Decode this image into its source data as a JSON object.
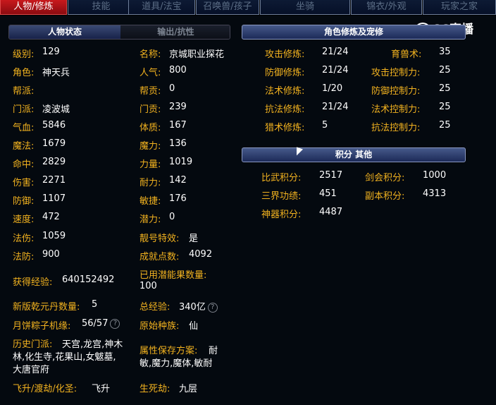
{
  "tabs": [
    {
      "label": "人物/修炼"
    },
    {
      "label": "技能"
    },
    {
      "label": "道具/法宝"
    },
    {
      "label": "召唤兽/孩子"
    },
    {
      "label": "坐骑"
    },
    {
      "label": "锦衣/外观"
    },
    {
      "label": "玩家之家"
    }
  ],
  "watermark": {
    "text": "CC直播",
    "logo": "cc-live-logo"
  },
  "left_header": {
    "tab1": "人物状态",
    "tab2": "输出/抗性"
  },
  "attrs": {
    "level_l": "级别:",
    "level_v": "129",
    "name_l": "名称:",
    "name_v": "京城职业探花",
    "role_l": "角色:",
    "role_v": "神天兵",
    "pop_l": "人气:",
    "pop_v": "800",
    "guild_l": "帮派:",
    "guild_v": "",
    "guildc_l": "帮贡:",
    "guildc_v": "0",
    "sect_l": "门派:",
    "sect_v": "凌波城",
    "sectc_l": "门贡:",
    "sectc_v": "239",
    "hp_l": "气血:",
    "hp_v": "5846",
    "con_l": "体质:",
    "con_v": "167",
    "mp_l": "魔法:",
    "mp_v": "1679",
    "mag_l": "魔力:",
    "mag_v": "136",
    "hit_l": "命中:",
    "hit_v": "2829",
    "str_l": "力量:",
    "str_v": "1019",
    "dmg_l": "伤害:",
    "dmg_v": "2271",
    "end_l": "耐力:",
    "end_v": "142",
    "def_l": "防御:",
    "def_v": "1107",
    "agi_l": "敏捷:",
    "agi_v": "176",
    "spd_l": "速度:",
    "spd_v": "472",
    "pot_l": "潜力:",
    "pot_v": "0",
    "mdmg_l": "法伤:",
    "mdmg_v": "1059",
    "title_l": "靓号特效:",
    "title_v": "是",
    "mdef_l": "法防:",
    "mdef_v": "900",
    "ach_l": "成就点数:",
    "ach_v": "4092",
    "exp_l": "获得经验:",
    "exp_v": "640152492",
    "potfruit_l": "已用潜能果数量:",
    "potfruit_v": "100",
    "qy_l": "新版乾元丹数量:",
    "qy_v": "5",
    "total_l": "总经验:",
    "total_v": "340亿",
    "moon_l": "月饼粽子机缘:",
    "moon_v": "56/57",
    "race_l": "原始种族:",
    "race_v": "仙",
    "hist_l": "历史门派:",
    "hist_v1": "天宫,龙宫,神木",
    "hist_v2": "林,化生寺,花果山,女魃墓,",
    "hist_v3": "大唐官府",
    "save_l": "属性保存方案:",
    "save_v1": "耐",
    "save_v2": "敏,魔力,魔体,敏耐",
    "fly_l": "飞升/渡劫/化圣:",
    "fly_v": "飞升",
    "life_l": "生死劫:",
    "life_v": "九层"
  },
  "cult_header": "角色修炼及宠修",
  "cult": {
    "atk_l": "攻击修炼:",
    "atk_v": "21/24",
    "beast_l": "育兽术:",
    "beast_v": "35",
    "def_l": "防御修炼:",
    "def_v": "21/24",
    "atkc_l": "攻击控制力:",
    "atkc_v": "25",
    "mag_l": "法术修炼:",
    "mag_v": "1/20",
    "defc_l": "防御控制力:",
    "defc_v": "25",
    "res_l": "抗法修炼:",
    "res_v": "21/24",
    "magc_l": "法术控制力:",
    "magc_v": "25",
    "hunt_l": "猎术修炼:",
    "hunt_v": "5",
    "resc_l": "抗法控制力:",
    "resc_v": "25"
  },
  "score_header": "积分 其他",
  "score": {
    "pvp_l": "比武积分:",
    "pvp_v": "2517",
    "sword_l": "剑会积分:",
    "sword_v": "1000",
    "merit_l": "三界功绩:",
    "merit_v": "451",
    "dungeon_l": "副本积分:",
    "dungeon_v": "4313",
    "artifact_l": "神器积分:",
    "artifact_v": "4487"
  },
  "colors": {
    "label": "#f2b21f",
    "value": "#ffffff",
    "active_tab": "#c8191d",
    "background": "#04090f"
  }
}
